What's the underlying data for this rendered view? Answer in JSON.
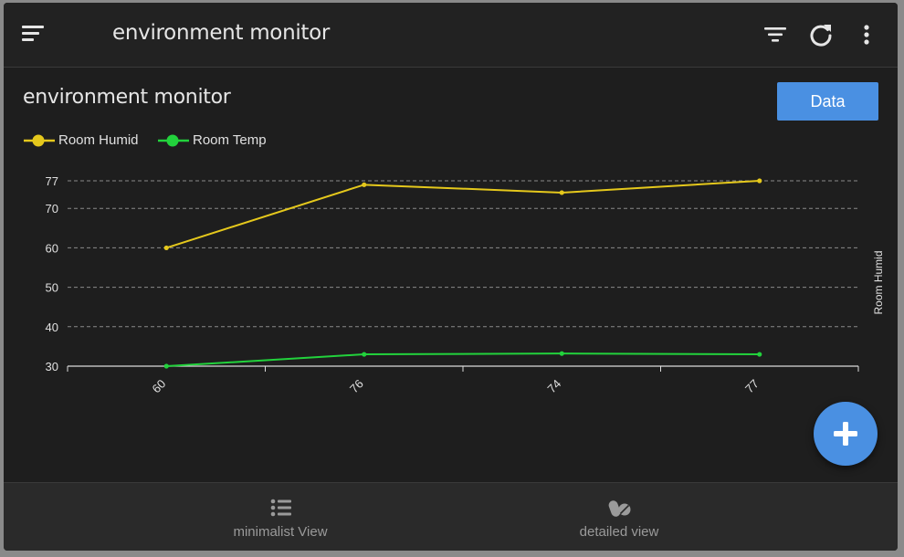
{
  "header": {
    "title": "environment monitor",
    "icons": [
      "menu-icon",
      "filter-icon",
      "refresh-icon",
      "more-vertical-icon"
    ]
  },
  "card": {
    "title": "environment monitor",
    "data_button_label": "Data"
  },
  "colors": {
    "accent": "#4a90e2",
    "humid": "#e5c81c",
    "temp": "#22d23c",
    "background": "#1e1e1e"
  },
  "chart_data": {
    "type": "line",
    "categories": [
      "60",
      "76",
      "74",
      "77"
    ],
    "series": [
      {
        "name": "Room Humid",
        "color": "#e5c81c",
        "values": [
          60,
          76,
          74,
          77
        ]
      },
      {
        "name": "Room Temp",
        "color": "#22d23c",
        "values": [
          30,
          33,
          33.2,
          33
        ]
      }
    ],
    "yticks": [
      "30",
      "40",
      "50",
      "60",
      "70",
      "77"
    ],
    "ylim": [
      30,
      77
    ],
    "ylabel_right": "Room Humid",
    "grid": true,
    "grid_style": "dashed",
    "legend": "top-left"
  },
  "fab": {
    "icon": "plus-icon"
  },
  "bottom_nav": {
    "items": [
      {
        "label": "minimalist View",
        "icon": "list-icon"
      },
      {
        "label": "detailed view",
        "icon": "pills-icon"
      }
    ]
  }
}
